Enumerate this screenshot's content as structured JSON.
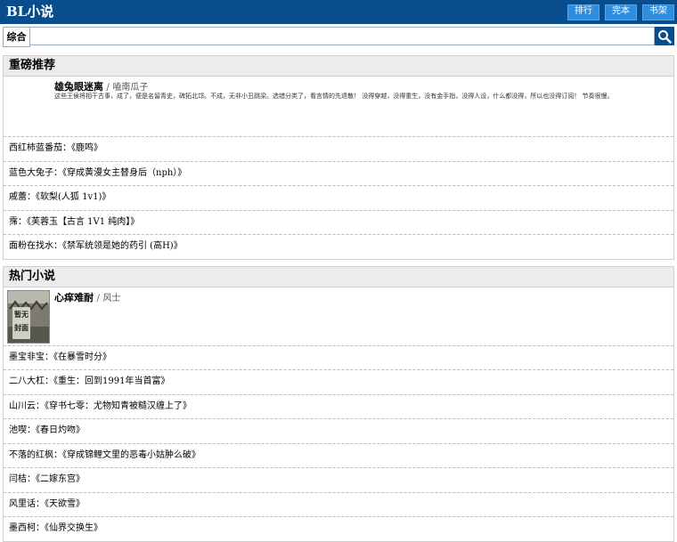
{
  "header": {
    "logo": "BL小说",
    "buttons": [
      "排行",
      "完本",
      "书架"
    ]
  },
  "search": {
    "category": "综合",
    "placeholder": "",
    "value": ""
  },
  "recommend": {
    "heading": "重磅推荐",
    "feature": {
      "title": "雄兔眼迷离",
      "author": "嗑南瓜子",
      "desc": "这些王侯将相干古事，成了，便是名留青史，碑拓北邙。不成，无非小丑跳梁。选错分类了，看言情的先退散！ 没得穿越，没得重生，没有金手指，没得人设，什么都没得，所以也没得订阅！ 节奏很慢。"
    },
    "items": [
      {
        "author": "西红柿蓝番茄",
        "title": "《鹿鸣》"
      },
      {
        "author": "蓝色大兔子",
        "title": "《穿成黄漫女主替身后（nph）》"
      },
      {
        "author": "戚蕾",
        "title": "《软梨(人狐 1v1)》"
      },
      {
        "author": "霈",
        "title": "《芙蓉玉【古言 1V1 纯肉】》"
      },
      {
        "author": "面粉在找水",
        "title": "《禁军统领是她的药引 (高H)》"
      }
    ]
  },
  "hot": {
    "heading": "热门小说",
    "feature": {
      "title": "心痒难耐",
      "author": "风士",
      "cover_text": "暂无封面"
    },
    "items": [
      {
        "author": "墨宝非宝",
        "title": "《在暴雪时分》"
      },
      {
        "author": "二八大杠",
        "title": "《重生：回到1991年当首富》"
      },
      {
        "author": "山川云",
        "title": "《穿书七零：尤物知青被糙汉缠上了》"
      },
      {
        "author": "池喫",
        "title": "《春日灼吻》"
      },
      {
        "author": "不落的红枫",
        "title": "《穿成锦鲤文里的恶毒小姑肿么破》"
      },
      {
        "author": "闫桔",
        "title": "《二嫁东宫》"
      },
      {
        "author": "风里话",
        "title": "《天欲雪》"
      },
      {
        "author": "墨西柯",
        "title": "《仙界交换生》"
      }
    ]
  },
  "colors": {
    "topbar": "#0a4d8c",
    "button": "#2f8ddd"
  }
}
